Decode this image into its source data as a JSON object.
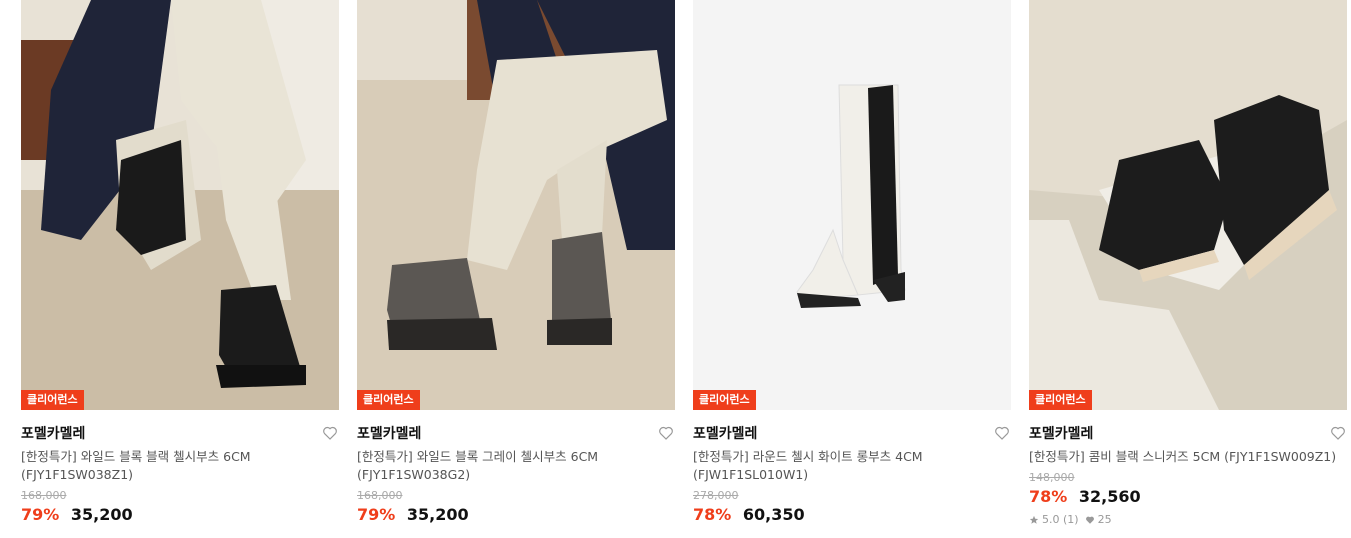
{
  "products": [
    {
      "badge": "클리어런스",
      "brand": "포멜카멜레",
      "name": "[한정특가] 와일드 블록 블랙 첼시부츠 6CM (FJY1F1SW038Z1)",
      "original_price": "168,000",
      "discount": "79%",
      "price": "35,200",
      "image": "black-chelsea-boots-photo"
    },
    {
      "badge": "클리어런스",
      "brand": "포멜카멜레",
      "name": "[한정특가] 와일드 블록 그레이 첼시부츠 6CM (FJY1F1SW038G2)",
      "original_price": "168,000",
      "discount": "79%",
      "price": "35,200",
      "image": "gray-chelsea-boots-photo"
    },
    {
      "badge": "클리어런스",
      "brand": "포멜카멜레",
      "name": "[한정특가] 라운드 첼시 화이트 롱부츠 4CM (FJW1F1SL010W1)",
      "original_price": "278,000",
      "discount": "78%",
      "price": "60,350",
      "image": "white-long-boot-photo"
    },
    {
      "badge": "클리어런스",
      "brand": "포멜카멜레",
      "name": "[한정특가] 콤비 블랙 스니커즈 5CM (FJY1F1SW009Z1)",
      "original_price": "148,000",
      "discount": "78%",
      "price": "32,560",
      "rating": "5.0 (1)",
      "likes": "25",
      "image": "black-sneakers-photo"
    }
  ],
  "icons": {
    "wishlist": "heart-outline-icon",
    "rating": "star-icon",
    "likes": "heart-filled-icon"
  },
  "colors": {
    "accent": "#ef3e1b"
  }
}
